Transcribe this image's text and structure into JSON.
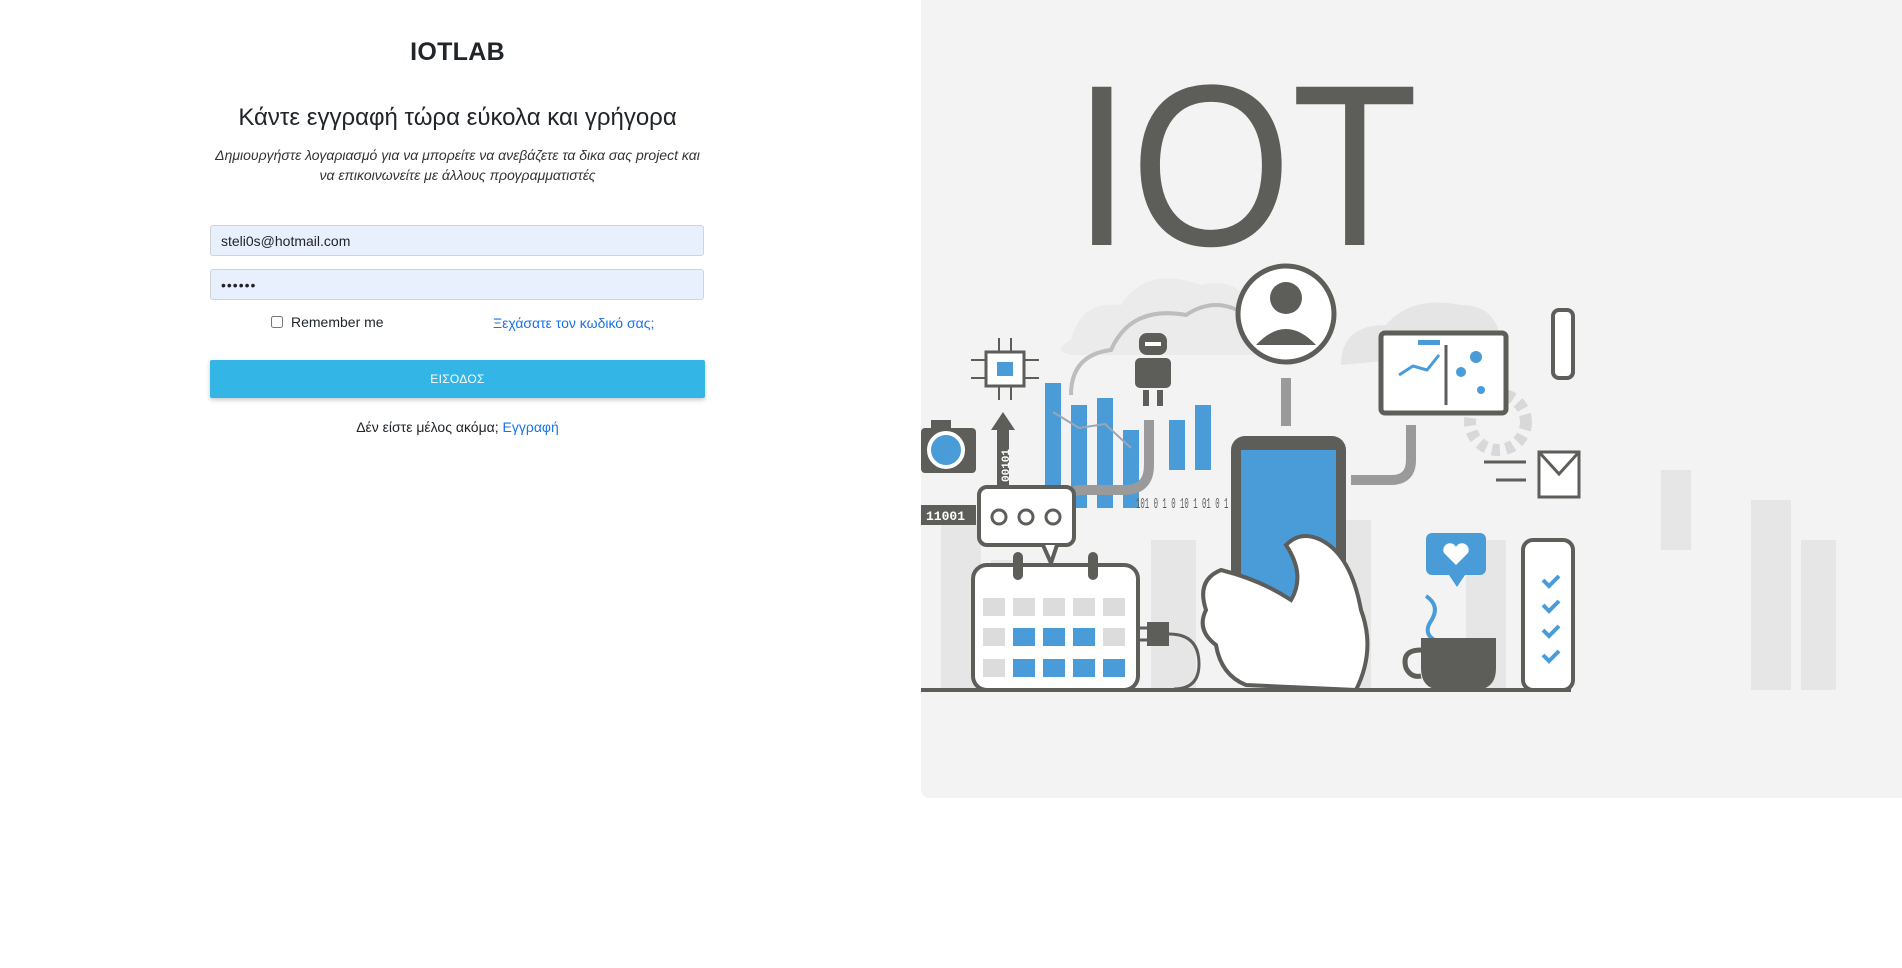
{
  "brand": "IOTLAB",
  "heading": "Κάντε εγγραφή τώρα εύκολα και γρήγορα",
  "subtext": "Δημιουργήστε λογαριασμό για να μπορείτε να ανεβάζετε τα δικα σας project και να επικοινωνείτε με άλλους προγραμματιστές",
  "form": {
    "email_value": "steli0s@hotmail.com",
    "password_value": "••••••",
    "remember_label": "Remember me",
    "forgot_label": "Ξεχάσατε τον κωδικό σας;",
    "submit_label": "ΕΙΣΟΔΟΣ",
    "signup_prompt": "Δέν είστε μέλος ακόμα;",
    "signup_link": "Εγγραφή"
  },
  "illustration": {
    "title": "IOT",
    "binary_1": "11001",
    "binary_2": "00101",
    "binary_cloud": "101 0 1 0 10 1 01 0 1 1 0",
    "colors": {
      "accent": "#4a9cd8",
      "dark": "#5d5d5a",
      "light": "#dcdcdc"
    }
  }
}
